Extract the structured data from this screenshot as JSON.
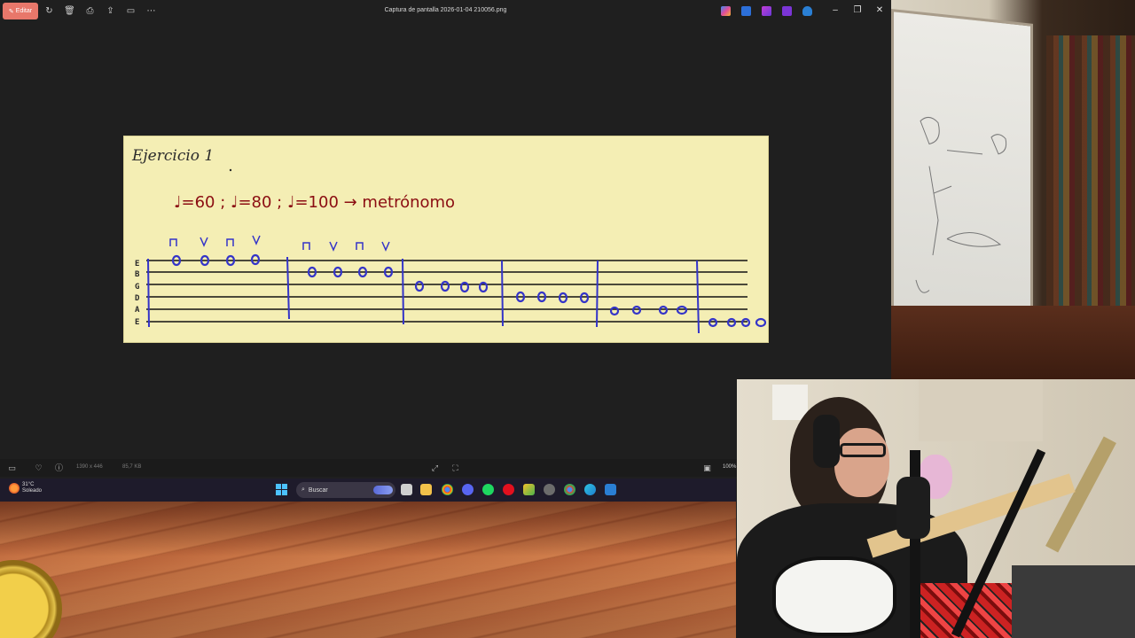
{
  "viewer": {
    "edit_label": "Editar",
    "title": "Captura de pantalla 2026-01-04 210056.png",
    "status": {
      "dimensions": "1390 x 446",
      "size": "85,7 KB",
      "zoom": "100%"
    }
  },
  "canvas": {
    "heading": "Ejercicio 1",
    "tempo_line": "♩=60 ; ♩=80 ; ♩=100 → metrónomo",
    "strings": [
      "E",
      "B",
      "G",
      "D",
      "A",
      "E"
    ],
    "ink_red": "#8b0d12",
    "ink_blue": "#3434c8"
  },
  "taskbar": {
    "weather_temp": "31°C",
    "weather_desc": "Soleado",
    "search_label": "Buscar"
  }
}
